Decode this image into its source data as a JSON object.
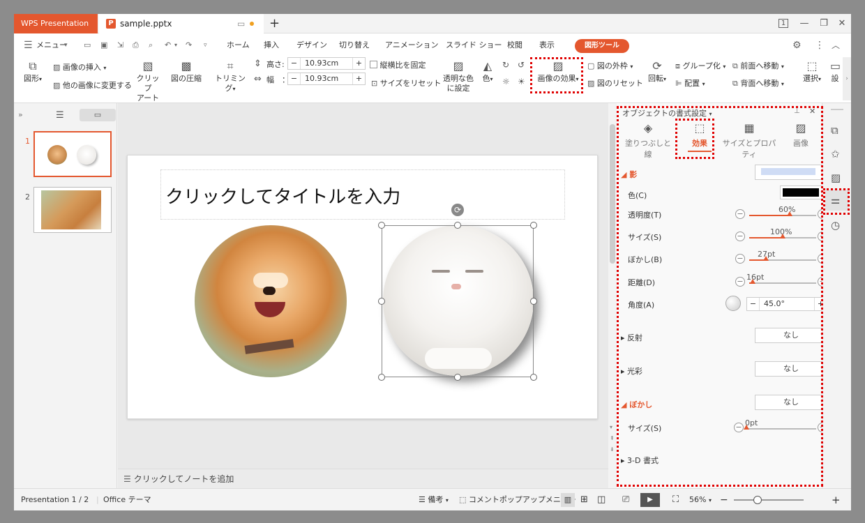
{
  "titlebar": {
    "app_tab": "WPS Presentation",
    "doc_tab": "sample.pptx",
    "page_indicator": "1"
  },
  "menu": {
    "menu_label": "メニュー",
    "tabs": [
      "ホーム",
      "挿入",
      "デザイン",
      "切り替え",
      "アニメーション",
      "スライド ショー",
      "校閲",
      "表示"
    ],
    "active_tab": "図形ツール"
  },
  "ribbon": {
    "shape": "図形",
    "insert_image": "画像の挿入",
    "change_image": "他の画像に変更する",
    "clipart_1": "クリップ",
    "clipart_2": "アート",
    "compress": "図の圧縮",
    "trim": "トリミング",
    "height_label": "高さ:",
    "height_value": "10.93cm",
    "width_label": "幅　：",
    "width_value": "10.93cm",
    "lock_ratio": "縦横比を固定",
    "reset_size": "サイズをリセット",
    "transparent_1": "透明な色",
    "transparent_2": "に設定",
    "color": "色",
    "effect": "画像の効果",
    "border": "図の外枠",
    "reset_image": "図のリセット",
    "rotate": "回転",
    "group": "グループ化",
    "align": "配置",
    "bring_front": "前面へ移動",
    "send_back": "背面へ移動",
    "select": "選択",
    "settings": "設"
  },
  "slides_panel": {
    "numbers": [
      "1",
      "2"
    ]
  },
  "slide": {
    "title_placeholder": "クリックしてタイトルを入力"
  },
  "notes": {
    "placeholder": "クリックしてノートを追加"
  },
  "panel": {
    "title": "オブジェクトの書式設定",
    "tabs": {
      "fill": "塗りつぶしと線",
      "effect": "効果",
      "size": "サイズとプロパティ",
      "image": "画像"
    },
    "shadow_header": "影",
    "color_label": "色(C)",
    "transparency_label": "透明度(T)",
    "transparency_value": "60%",
    "transparency_pct": 60,
    "size_label": "サイズ(S)",
    "size_value": "100%",
    "size_pct": 50,
    "blur_label": "ぼかし(B)",
    "blur_value": "27pt",
    "blur_pct": 25,
    "distance_label": "距離(D)",
    "distance_value": "16pt",
    "distance_pct": 5,
    "angle_label": "角度(A)",
    "angle_value": "45.0°",
    "reflection_label": "反射",
    "reflection_value": "なし",
    "glow_label": "光彩",
    "glow_value": "なし",
    "soft_header": "ぼかし",
    "soft_value": "なし",
    "soft_size_label": "サイズ(S)",
    "soft_size_value": "0pt",
    "soft_size_pct": 0,
    "threed_label": "3-D 書式"
  },
  "status": {
    "slide_info": "Presentation 1 / 2",
    "theme": "Office テーマ",
    "notes": "備考",
    "comment": "コメントポップアップメニュー",
    "zoom": "56%"
  },
  "colors": {
    "accent": "#e4572e",
    "highlight": "#e00000"
  }
}
